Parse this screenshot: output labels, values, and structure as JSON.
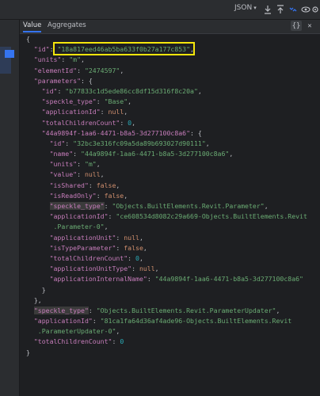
{
  "toolbar": {
    "format_value": "JSON",
    "icons": [
      "align-down-icon",
      "align-up-icon",
      "expand-collapse-icon",
      "eye-icon",
      "settings-icon"
    ]
  },
  "tabs": {
    "value": "Value",
    "aggregates": "Aggregates"
  },
  "tab_tools": {
    "braces": "{}",
    "close": "✕"
  },
  "colors": {
    "key": "#c77dbb",
    "string": "#6aab73",
    "number": "#2aacb8",
    "keyword": "#cf8e6d",
    "punct": "#bcbec4",
    "highlight_box": "#f5e60c"
  },
  "lines": [
    {
      "i": 0,
      "tokens": [
        [
          "p",
          "{"
        ]
      ]
    },
    {
      "i": 1,
      "tokens": [
        [
          "k",
          "\"id\""
        ],
        [
          "p",
          ": "
        ],
        [
          "s",
          "\"18a817eed46ab5ba633f0b27a177c853\""
        ],
        [
          "p",
          ","
        ]
      ]
    },
    {
      "i": 1,
      "tokens": [
        [
          "k",
          "\"units\""
        ],
        [
          "p",
          ": "
        ],
        [
          "s",
          "\"m\""
        ],
        [
          "p",
          ","
        ]
      ]
    },
    {
      "i": 1,
      "tokens": [
        [
          "k",
          "\"elementId\""
        ],
        [
          "p",
          ": "
        ],
        [
          "s",
          "\"2474597\""
        ],
        [
          "p",
          ","
        ]
      ]
    },
    {
      "i": 1,
      "tokens": [
        [
          "k",
          "\"parameters\""
        ],
        [
          "p",
          ": {"
        ]
      ]
    },
    {
      "i": 2,
      "tokens": [
        [
          "k",
          "\"id\""
        ],
        [
          "p",
          ": "
        ],
        [
          "s",
          "\"b77833c1d5ede86cc8df15d316f8c20a\""
        ],
        [
          "p",
          ","
        ]
      ]
    },
    {
      "i": 2,
      "tokens": [
        [
          "k",
          "\"speckle_type\""
        ],
        [
          "p",
          ": "
        ],
        [
          "s",
          "\"Base\""
        ],
        [
          "p",
          ","
        ]
      ]
    },
    {
      "i": 2,
      "tokens": [
        [
          "k",
          "\"applicationId\""
        ],
        [
          "p",
          ": "
        ],
        [
          "kw",
          "null"
        ],
        [
          "p",
          ","
        ]
      ]
    },
    {
      "i": 2,
      "tokens": [
        [
          "k",
          "\"totalChildrenCount\""
        ],
        [
          "p",
          ": "
        ],
        [
          "n",
          "0"
        ],
        [
          "p",
          ","
        ]
      ]
    },
    {
      "i": 2,
      "tokens": [
        [
          "k",
          "\"44a9894f-1aa6-4471-b8a5-3d277100c8a6\""
        ],
        [
          "p",
          ": {"
        ]
      ]
    },
    {
      "i": 3,
      "tokens": [
        [
          "k",
          "\"id\""
        ],
        [
          "p",
          ": "
        ],
        [
          "s",
          "\"32bc3e316fc09a5da89b693027d90111\""
        ],
        [
          "p",
          ","
        ]
      ]
    },
    {
      "i": 3,
      "tokens": [
        [
          "k",
          "\"name\""
        ],
        [
          "p",
          ": "
        ],
        [
          "s",
          "\"44a9894f-1aa6-4471-b8a5-3d277100c8a6\""
        ],
        [
          "p",
          ","
        ]
      ]
    },
    {
      "i": 3,
      "tokens": [
        [
          "k",
          "\"units\""
        ],
        [
          "p",
          ": "
        ],
        [
          "s",
          "\"m\""
        ],
        [
          "p",
          ","
        ]
      ]
    },
    {
      "i": 3,
      "tokens": [
        [
          "k",
          "\"value\""
        ],
        [
          "p",
          ": "
        ],
        [
          "kw",
          "null"
        ],
        [
          "p",
          ","
        ]
      ]
    },
    {
      "i": 3,
      "tokens": [
        [
          "k",
          "\"isShared\""
        ],
        [
          "p",
          ": "
        ],
        [
          "kw",
          "false"
        ],
        [
          "p",
          ","
        ]
      ]
    },
    {
      "i": 3,
      "tokens": [
        [
          "k",
          "\"isReadOnly\""
        ],
        [
          "p",
          ": "
        ],
        [
          "kw",
          "false"
        ],
        [
          "p",
          ","
        ]
      ]
    },
    {
      "i": 3,
      "tokens": [
        [
          "k",
          "\"speckle_type\"",
          "hl"
        ],
        [
          "p",
          ": "
        ],
        [
          "s",
          "\"Objects.BuiltElements.Revit.Parameter\""
        ],
        [
          "p",
          ","
        ]
      ]
    },
    {
      "i": 3,
      "tokens": [
        [
          "k",
          "\"applicationId\""
        ],
        [
          "p",
          ": "
        ],
        [
          "s",
          "\"ce608534d8082c29a669-Objects.BuiltElements.Revit"
        ]
      ]
    },
    {
      "i": 3,
      "tokens": [
        [
          "s",
          " .Parameter-0\""
        ],
        [
          "p",
          ","
        ]
      ]
    },
    {
      "i": 3,
      "tokens": [
        [
          "k",
          "\"applicationUnit\""
        ],
        [
          "p",
          ": "
        ],
        [
          "kw",
          "null"
        ],
        [
          "p",
          ","
        ]
      ]
    },
    {
      "i": 3,
      "tokens": [
        [
          "k",
          "\"isTypeParameter\""
        ],
        [
          "p",
          ": "
        ],
        [
          "kw",
          "false"
        ],
        [
          "p",
          ","
        ]
      ]
    },
    {
      "i": 3,
      "tokens": [
        [
          "k",
          "\"totalChildrenCount\""
        ],
        [
          "p",
          ": "
        ],
        [
          "n",
          "0"
        ],
        [
          "p",
          ","
        ]
      ]
    },
    {
      "i": 3,
      "tokens": [
        [
          "k",
          "\"applicationUnitType\""
        ],
        [
          "p",
          ": "
        ],
        [
          "kw",
          "null"
        ],
        [
          "p",
          ","
        ]
      ]
    },
    {
      "i": 3,
      "tokens": [
        [
          "k",
          "\"applicationInternalName\""
        ],
        [
          "p",
          ": "
        ],
        [
          "s",
          "\"44a9894f-1aa6-4471-b8a5-3d277100c8a6\""
        ]
      ]
    },
    {
      "i": 2,
      "tokens": [
        [
          "p",
          "}"
        ]
      ]
    },
    {
      "i": 1,
      "tokens": [
        [
          "p",
          "},"
        ]
      ]
    },
    {
      "i": 1,
      "tokens": [
        [
          "k",
          "\"speckle_type\"",
          "hl"
        ],
        [
          "p",
          ": "
        ],
        [
          "s",
          "\"Objects.BuiltElements.Revit.ParameterUpdater\""
        ],
        [
          "p",
          ","
        ]
      ]
    },
    {
      "i": 1,
      "tokens": [
        [
          "k",
          "\"applicationId\""
        ],
        [
          "p",
          ": "
        ],
        [
          "s",
          "\"81ca1fa64d36af4ade96-Objects.BuiltElements.Revit"
        ]
      ]
    },
    {
      "i": 1,
      "tokens": [
        [
          "s",
          " .ParameterUpdater-0\""
        ],
        [
          "p",
          ","
        ]
      ]
    },
    {
      "i": 1,
      "tokens": [
        [
          "k",
          "\"totalChildrenCount\""
        ],
        [
          "p",
          ": "
        ],
        [
          "n",
          "0"
        ]
      ]
    },
    {
      "i": 0,
      "tokens": [
        [
          "p",
          "}"
        ]
      ]
    }
  ]
}
